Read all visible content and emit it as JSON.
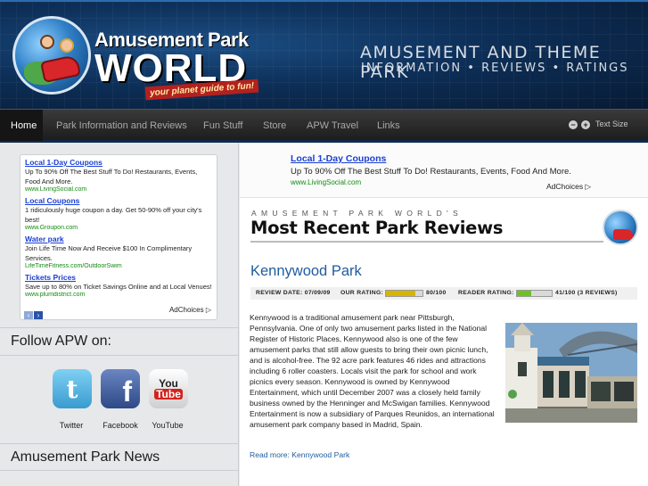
{
  "header": {
    "logo_line1": "Amusement Park",
    "logo_line2": "WORLD",
    "logo_tagline": "your planet guide to fun!",
    "title_line1": "AMUSEMENT AND THEME PARK",
    "title_line2": "INFORMATION • REVIEWS • RATINGS"
  },
  "nav": {
    "items": [
      "Home",
      "Park Information and Reviews",
      "Fun Stuff",
      "Store",
      "APW Travel",
      "Links"
    ],
    "text_size_label": "Text Size",
    "decrease_symbol": "−",
    "increase_symbol": "+"
  },
  "sidebar": {
    "ads": [
      {
        "title": "Local 1-Day Coupons",
        "desc": "Up To 90% Off The Best Stuff To Do! Restaurants, Events, Food And More.",
        "url": "www.LivingSocial.com"
      },
      {
        "title": "Local Coupons",
        "desc": "1 ridiculously huge coupon a day. Get 50-90% off your city's best!",
        "url": "www.Groupon.com"
      },
      {
        "title": "Water park",
        "desc": "Join Life Time Now And Receive $100 In Complimentary Services.",
        "url": "LifeTimeFitness.com/OutdoorSwim"
      },
      {
        "title": "Tickets Prices",
        "desc": "Save up to 80% on Ticket Savings Online and at Local Venues!",
        "url": "www.plumdistrict.com"
      }
    ],
    "prev_symbol": "‹",
    "next_symbol": "›",
    "adchoices": "AdChoices ▷",
    "follow_heading": "Follow APW on:",
    "social": [
      {
        "label": "Twitter",
        "glyph": "t",
        "color": "#5ab8e6",
        "icon": "twitter-icon"
      },
      {
        "label": "Facebook",
        "glyph": "f",
        "color": "#3b5998",
        "icon": "facebook-icon"
      },
      {
        "label": "YouTube",
        "glyph": "You\nTube",
        "color": "#e9e9e9",
        "icon": "youtube-icon"
      }
    ],
    "news_heading": "Amusement Park News"
  },
  "main": {
    "top_ad": {
      "title": "Local 1-Day Coupons",
      "desc": "Up To 90% Off The Best Stuff To Do! Restaurants, Events, Food And More.",
      "url": "www.LivingSocial.com",
      "adchoices": "AdChoices ▷"
    },
    "section_kicker": "AMUSEMENT PARK WORLD'S",
    "section_title": "Most Recent Park Reviews",
    "review": {
      "park_name": "Kennywood Park",
      "review_date_label": "REVIEW DATE: 07/09/09",
      "our_rating_label": "OUR RATING:",
      "our_rating_value": "80/100",
      "our_rating": 80,
      "reader_rating_label": "READER RATING:",
      "reader_rating_value": "41/100 (3 REVIEWS)",
      "reader_rating": 41,
      "our_bar_color": "#d6b400",
      "reader_bar_color": "#6cc31f",
      "body": "Kennywood is a traditional amusement park near Pittsburgh, Pennsylvania.  One of only two amusement parks listed in the National Register of Historic Places, Kennywood also is one of the few amusement parks that still allow guests to bring their own picnic lunch, and is alcohol-free.  The 92 acre park features 46 rides and attractions including 6 roller coasters.  Locals visit the park for school and work picnics every season.  Kennywood is owned by Kennywood Entertainment, which until December 2007 was a closely held family business owned by the Henninger and McSwigan families. Kennywood Entertainment is now a subsidiary of Parques Reunidos, an international amusement park company based in Madrid, Spain.",
      "read_more": "Read more: Kennywood Park"
    }
  },
  "colors": {
    "header_bg": "#0d2f58",
    "link_blue": "#1f5c9e",
    "ad_title": "#1a3fd3",
    "ad_url": "#138a13"
  }
}
